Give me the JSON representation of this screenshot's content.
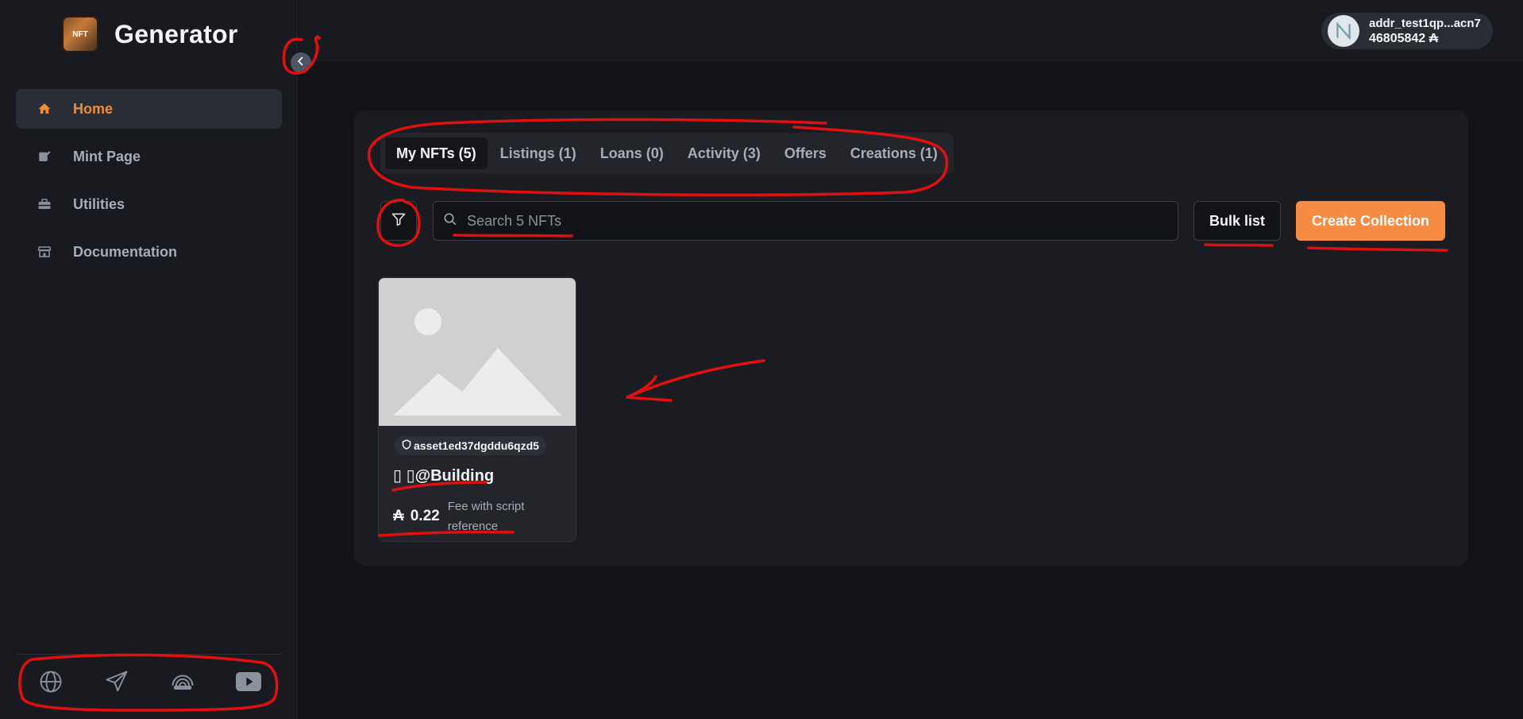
{
  "app": {
    "title": "Generator",
    "logo_text": "NFT"
  },
  "sidebar": {
    "items": [
      {
        "label": "Home",
        "icon": "home-icon",
        "active": true
      },
      {
        "label": "Mint Page",
        "icon": "edit-icon",
        "active": false
      },
      {
        "label": "Utilities",
        "icon": "toolbox-icon",
        "active": false
      },
      {
        "label": "Documentation",
        "icon": "store-icon",
        "active": false
      }
    ],
    "socials": [
      "globe-icon",
      "telegram-icon",
      "rainbow-icon",
      "youtube-icon"
    ]
  },
  "wallet": {
    "address": "addr_test1qp...acn7",
    "balance": "46805842 ₳"
  },
  "tabs": [
    {
      "label": "My NFTs (5)",
      "active": true
    },
    {
      "label": "Listings (1)",
      "active": false
    },
    {
      "label": "Loans (0)",
      "active": false
    },
    {
      "label": "Activity (3)",
      "active": false
    },
    {
      "label": "Offers",
      "active": false
    },
    {
      "label": "Creations (1)",
      "active": false
    }
  ],
  "toolbar": {
    "search_placeholder": "Search 5 NFTs",
    "bulk_label": "Bulk list",
    "create_label": "Create Collection"
  },
  "nfts": [
    {
      "asset": "asset1ed37dgddu6qzd5",
      "name": "▯ ▯@Building",
      "price": "0.22",
      "currency": "₳",
      "note": "Fee with script reference"
    }
  ],
  "colors": {
    "accent": "#f68b43",
    "annotation": "#e01010"
  }
}
